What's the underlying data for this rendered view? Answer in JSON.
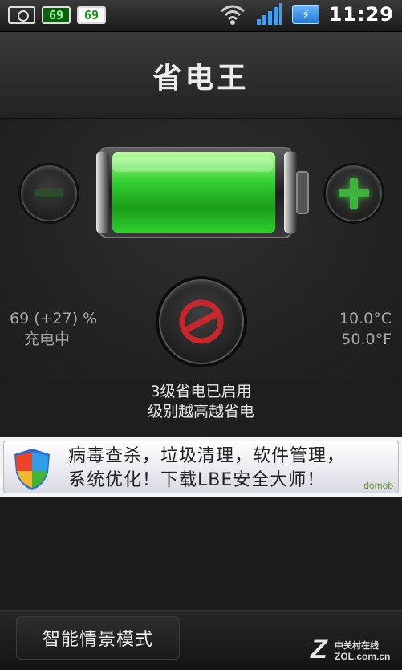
{
  "status_bar": {
    "battery_badge_1": "69",
    "battery_badge_2": "69",
    "charge_symbol": "⚡",
    "time": "11:29",
    "icons": [
      "camera-icon",
      "battery-widget-icon",
      "battery-widget-icon",
      "wifi-icon",
      "signal-icon",
      "charging-icon"
    ]
  },
  "header": {
    "title": "省电王"
  },
  "battery": {
    "percent_text": "69 (+27) %",
    "state_text": "充电中",
    "temp_c": "10.0°C",
    "temp_f": "50.0°F",
    "level": 0.69,
    "fill_color": "#3fdc3f"
  },
  "controls": {
    "decrease_icon": "minus-icon",
    "increase_icon": "plus-icon",
    "power_icon": "power-saving-toggle-icon",
    "power_color": "#c8262a"
  },
  "status": {
    "line1": "3级省电已启用",
    "line2": "级别越高越省电"
  },
  "ad": {
    "line1": "病毒查杀，垃圾清理，软件管理，",
    "line2": "系统优化！下载LBE安全大师！",
    "brand": "domob"
  },
  "bottom": {
    "mode_button": "智能情景模式"
  },
  "watermark": {
    "logo": "Z",
    "line1": "中关村在线",
    "line2": "ZOL.com.cn"
  }
}
